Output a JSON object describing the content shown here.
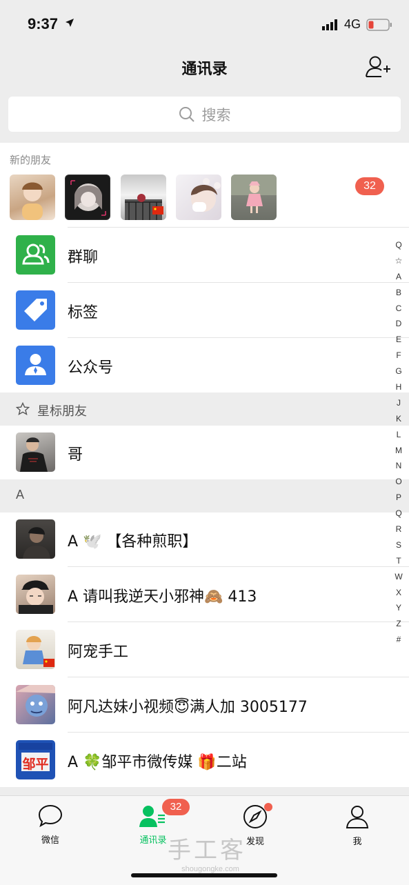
{
  "status": {
    "time": "9:37",
    "network": "4G"
  },
  "nav": {
    "title": "通讯录"
  },
  "search": {
    "placeholder": "搜索"
  },
  "new_friends": {
    "label": "新的朋友",
    "badge": "32"
  },
  "menu": [
    {
      "label": "群聊",
      "color": "#2fb14a",
      "icon": "group-icon"
    },
    {
      "label": "标签",
      "color": "#3a7ce8",
      "icon": "tag-icon"
    },
    {
      "label": "公众号",
      "color": "#3a7ce8",
      "icon": "official-account-icon"
    }
  ],
  "starred": {
    "header": "星标朋友",
    "contacts": [
      {
        "name": "哥"
      }
    ]
  },
  "section_a": {
    "letter": "A"
  },
  "contacts": [
    {
      "name": "A 🕊️ 【各种煎职】"
    },
    {
      "name": "A 请叫我逆天小邪神🙈 413"
    },
    {
      "name": "阿宠手工"
    },
    {
      "name": "阿凡达妹小视频😇满人加 3005177"
    },
    {
      "name": "A 🍀邹平市微传媒 🎁二站"
    }
  ],
  "avatar_text": {
    "zouping": "邹平"
  },
  "index_letters": [
    "Q",
    "☆",
    "A",
    "B",
    "C",
    "D",
    "E",
    "F",
    "G",
    "H",
    "J",
    "K",
    "L",
    "M",
    "N",
    "O",
    "P",
    "Q",
    "R",
    "S",
    "T",
    "W",
    "X",
    "Y",
    "Z",
    "#"
  ],
  "tabs": [
    {
      "label": "微信",
      "icon": "chat-icon"
    },
    {
      "label": "通讯录",
      "icon": "contacts-icon",
      "active": true
    },
    {
      "label": "发现",
      "icon": "compass-icon"
    },
    {
      "label": "我",
      "icon": "profile-icon"
    }
  ],
  "tab_badge": "32",
  "watermark": {
    "text": "手工客",
    "sub": "shougongke.com"
  },
  "colors": {
    "accent": "#07c160",
    "badge": "#f0604f",
    "background": "#ededed"
  }
}
